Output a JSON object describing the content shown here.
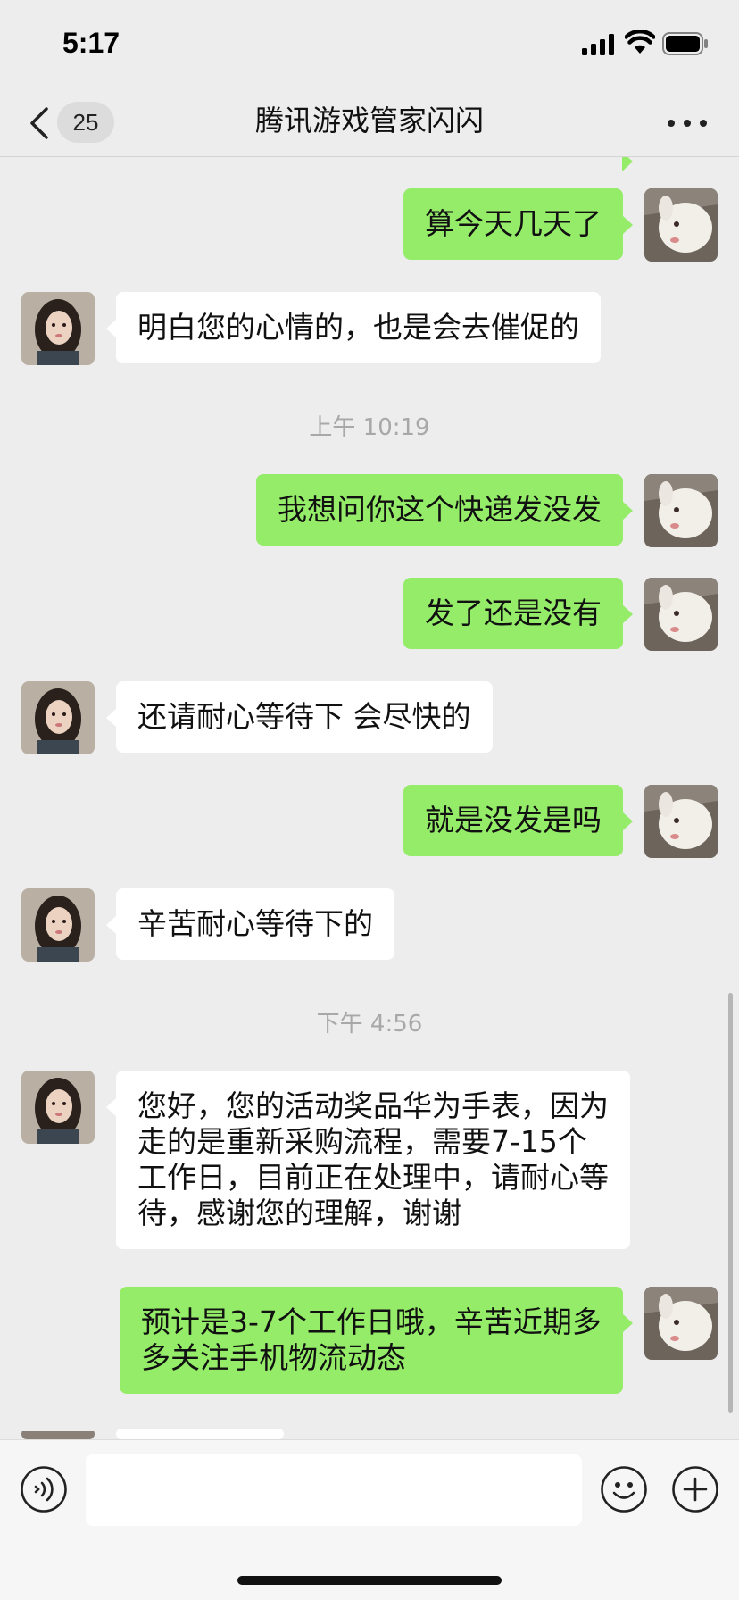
{
  "status_bar": {
    "time": "5:17",
    "icons": [
      "signal-icon",
      "wifi-icon",
      "battery-icon"
    ]
  },
  "nav": {
    "back_icon": "chevron-left-icon",
    "unread_count": "25",
    "title": "腾讯游戏管家闪闪",
    "more_icon": "more-dots-icon"
  },
  "messages": [
    {
      "side": "out",
      "text": "算今天几天了"
    },
    {
      "side": "in",
      "text": "明白您的心情的，也是会去催促的"
    },
    {
      "timestamp": "上午 10:19"
    },
    {
      "side": "out",
      "text": "我想问你这个快递发没发"
    },
    {
      "side": "out",
      "text": "发了还是没有"
    },
    {
      "side": "in",
      "text": "还请耐心等待下 会尽快的"
    },
    {
      "side": "out",
      "text": "就是没发是吗"
    },
    {
      "side": "in",
      "text": "辛苦耐心等待下的"
    },
    {
      "timestamp": "下午 4:56"
    },
    {
      "side": "in",
      "text": "您好，您的活动奖品华为手表，因为走的是重新采购流程，需要7-15个工作日，目前正在处理中，请耐心等待，感谢您的理解，谢谢"
    },
    {
      "side": "out",
      "text": "预计是3-7个工作日哦，辛苦近期多多关注手机物流动态"
    }
  ],
  "input_bar": {
    "voice_icon": "voice-icon",
    "input_value": "",
    "emoji_icon": "emoji-icon",
    "plus_icon": "plus-icon"
  },
  "colors": {
    "background": "#ededed",
    "outgoing_bubble": "#95ec69",
    "incoming_bubble": "#ffffff",
    "timestamp_text": "#a8a8a8"
  }
}
